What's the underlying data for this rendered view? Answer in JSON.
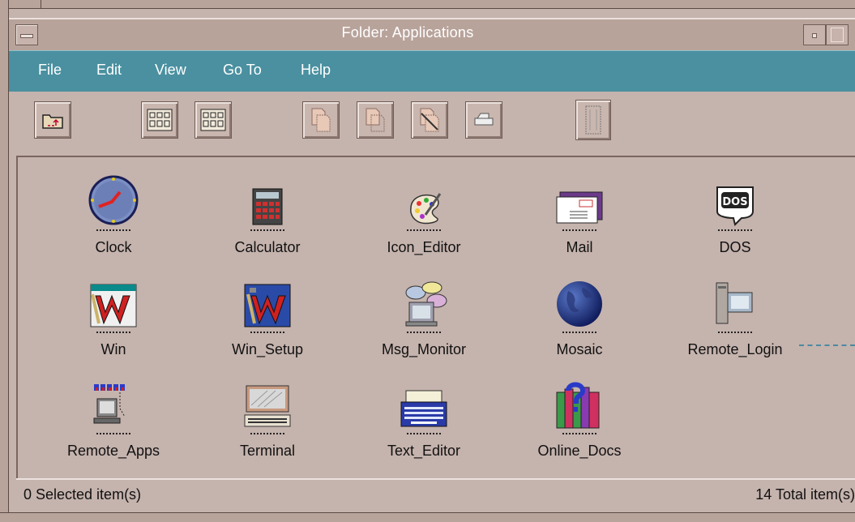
{
  "window": {
    "title": "Folder: Applications"
  },
  "menu": {
    "file": "File",
    "edit": "Edit",
    "view": "View",
    "goto": "Go To",
    "help": "Help"
  },
  "toolbar": {
    "icons": [
      "folder-up-icon",
      "view-large-icon",
      "view-small-icon",
      "copy-icon",
      "copy-outline-icon",
      "delete-doc-icon",
      "print-icon",
      "trash-icon"
    ]
  },
  "items": [
    {
      "label": "Clock"
    },
    {
      "label": "Calculator"
    },
    {
      "label": "Icon_Editor"
    },
    {
      "label": "Mail"
    },
    {
      "label": "DOS"
    },
    {
      "label": "Win"
    },
    {
      "label": "Win_Setup"
    },
    {
      "label": "Msg_Monitor"
    },
    {
      "label": "Mosaic"
    },
    {
      "label": "Remote_Login"
    },
    {
      "label": "Remote_Apps"
    },
    {
      "label": "Terminal"
    },
    {
      "label": "Text_Editor"
    },
    {
      "label": "Online_Docs"
    }
  ],
  "status": {
    "selected": "0 Selected item(s)",
    "total": "14 Total item(s)"
  },
  "colors": {
    "menubar": "#4a90a0",
    "background": "#c5b3ad"
  }
}
